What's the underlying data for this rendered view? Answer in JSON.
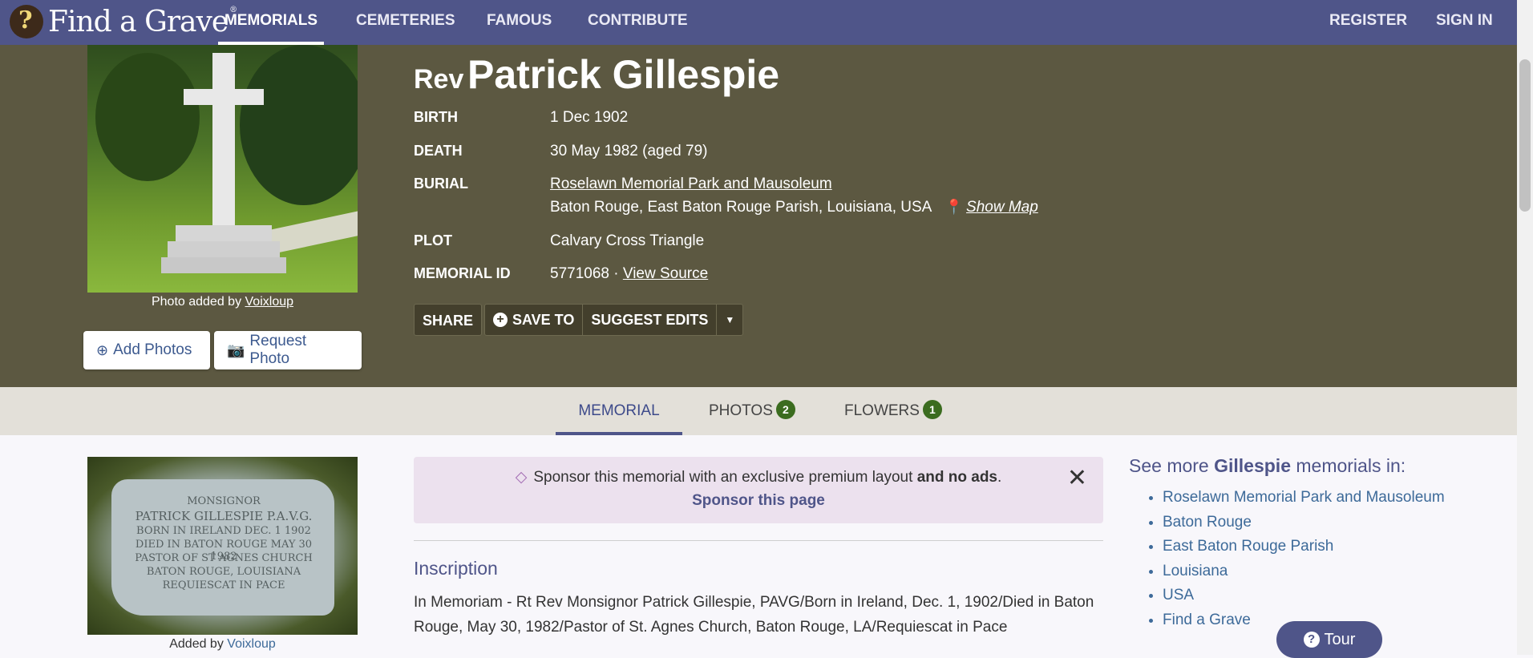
{
  "brand": {
    "name": "Find a Grave",
    "reg": "®"
  },
  "nav": {
    "items": [
      "MEMORIALS",
      "CEMETERIES",
      "FAMOUS",
      "CONTRIBUTE"
    ],
    "register": "REGISTER",
    "signin": "SIGN IN"
  },
  "memorial": {
    "prefix": "Rev",
    "name": "Patrick Gillespie",
    "photo_credit_prefix": "Photo added by",
    "photo_credit_user": "Voixloup",
    "add_photos": "Add Photos",
    "request_photo": "Request Photo",
    "facts": {
      "birth_label": "BIRTH",
      "birth_value": "1 Dec 1902",
      "death_label": "DEATH",
      "death_value": "30 May 1982 (aged 79)",
      "burial_label": "BURIAL",
      "burial_cemetery": "Roselawn Memorial Park and Mausoleum",
      "burial_location": "Baton Rouge, East Baton Rouge Parish, Louisiana, USA",
      "show_map": "Show Map",
      "plot_label": "PLOT",
      "plot_value": "Calvary Cross Triangle",
      "id_label": "MEMORIAL ID",
      "id_value": "5771068 ·",
      "view_source": "View Source"
    },
    "actions": {
      "share": "SHARE",
      "save_to": "SAVE TO",
      "suggest_edits": "SUGGEST EDITS"
    }
  },
  "tabs": [
    {
      "label": "MEMORIAL"
    },
    {
      "label": "PHOTOS",
      "count": "2"
    },
    {
      "label": "FLOWERS",
      "count": "1"
    }
  ],
  "grave_photo": {
    "engraving": [
      "MONSIGNOR",
      "PATRICK GILLESPIE P.A.V.G.",
      "BORN IN IRELAND DEC. 1 1902",
      "DIED IN BATON ROUGE MAY 30 1982",
      "PASTOR OF ST AGNES CHURCH",
      "BATON ROUGE, LOUISIANA",
      "REQUIESCAT IN PACE"
    ],
    "credit_prefix": "Added by",
    "credit_user": "Voixloup"
  },
  "sponsor": {
    "text": "Sponsor this memorial with an exclusive premium layout",
    "text_bold": "and no ads",
    "text_end": ".",
    "link": "Sponsor this page"
  },
  "inscription": {
    "heading": "Inscription",
    "text": "In Memoriam - Rt Rev Monsignor Patrick Gillespie, PAVG/Born in Ireland, Dec. 1, 1902/Died in Baton Rouge, May 30, 1982/Pastor of St. Agnes Church, Baton Rouge, LA/Requiescat in Pace"
  },
  "see_more": {
    "heading_prefix": "See more",
    "heading_name": "Gillespie",
    "heading_suffix": "memorials in:",
    "links": [
      "Roselawn Memorial Park and Mausoleum",
      "Baton Rouge",
      "East Baton Rouge Parish",
      "Louisiana",
      "USA",
      "Find a Grave"
    ]
  },
  "tour": {
    "label": "Tour"
  },
  "colors": {
    "nav": "#4f5589",
    "hero": "#5c5841",
    "tabbar": "#e3e0d9",
    "badge": "#3b6c1f",
    "sponsor_bg": "#ece1ee"
  }
}
